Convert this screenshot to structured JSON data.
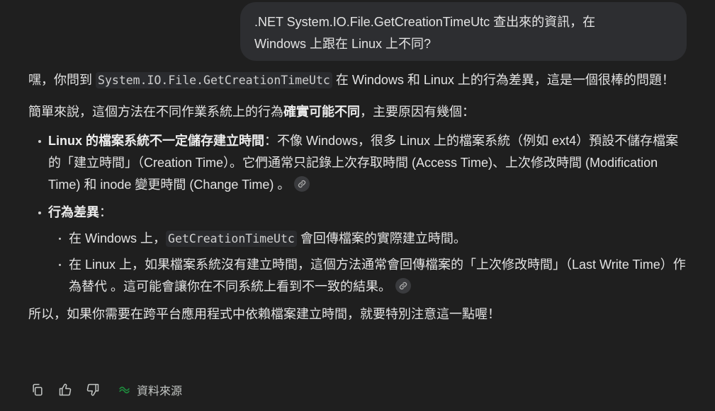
{
  "user_message": {
    "line1": ".NET System.IO.File.GetCreationTimeUtc 查出來的資訊，在",
    "line2": "Windows 上跟在 Linux 上不同?"
  },
  "answer": {
    "p1_pre": "嘿，你問到 ",
    "p1_code": "System.IO.File.GetCreationTimeUtc",
    "p1_post": " 在 Windows 和 Linux 上的行為差異，這是一個很棒的問題！",
    "p2_pre": "簡單來說，這個方法在不同作業系統上的行為",
    "p2_bold": "確實可能不同",
    "p2_post": "，主要原因有幾個：",
    "bullet1_bold": "Linux 的檔案系統不一定儲存建立時間",
    "bullet1_text": "：不像 Windows，很多 Linux 上的檔案系統（例如 ext4）預設不儲存檔案的「建立時間」（Creation Time）。它們通常只記錄上次存取時間 (Access Time)、上次修改時間 (Modification Time) 和 inode 變更時間 (Change Time) 。",
    "bullet2_bold": "行為差異",
    "bullet2_text": "：",
    "sub1_pre": "在 Windows 上，",
    "sub1_code": "GetCreationTimeUtc",
    "sub1_post": " 會回傳檔案的實際建立時間。",
    "sub2_text": "在 Linux 上，如果檔案系統沒有建立時間，這個方法通常會回傳檔案的「上次修改時間」（Last Write Time）作為替代 。這可能會讓你在不同系統上看到不一致的結果。",
    "p_last": "所以，如果你需要在跨平台應用程式中依賴檔案建立時間，就要特別注意這一點喔！"
  },
  "toolbar": {
    "copy_icon": "copy-icon",
    "thumbs_up_icon": "thumbs-up-icon",
    "thumbs_down_icon": "thumbs-down-icon",
    "sources_label": "資料來源",
    "sources_icon_color": "#1e8e3e"
  },
  "colors": {
    "background": "#1f1f1f",
    "bubble": "#2d2e31",
    "text": "#e3e3e3"
  }
}
